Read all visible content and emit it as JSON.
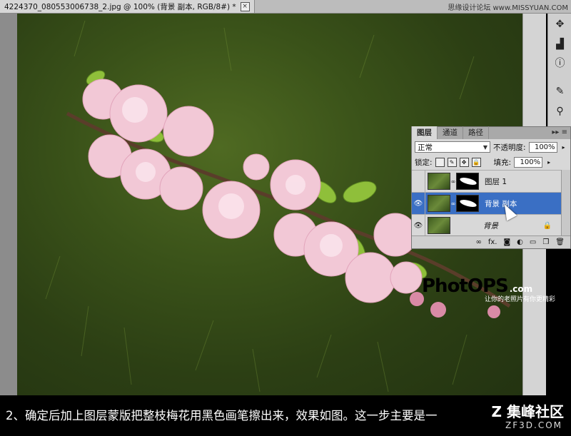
{
  "tab": {
    "title": "4224370_080553006738_2.jpg @ 100% (背景 副本, RGB/8#) *",
    "close": "×"
  },
  "watermark_top": "思缘设计论坛 www.MISSYUAN.COM",
  "layers_panel": {
    "tabs": [
      "图层",
      "通道",
      "路径"
    ],
    "blend_mode": "正常",
    "opacity_label": "不透明度:",
    "opacity_value": "100%",
    "lock_label": "锁定:",
    "fill_label": "填充:",
    "fill_value": "100%",
    "layers": [
      {
        "name": "图层 1",
        "visible": false
      },
      {
        "name": "背景 副本",
        "visible": true,
        "selected": true
      },
      {
        "name": "背景",
        "visible": true,
        "locked": true
      }
    ]
  },
  "logo": {
    "brand": "PhotOPS",
    "suffix": ".com",
    "slogan": "让你的老照片有你更精彩"
  },
  "caption": {
    "text": "2、确定后加上图层蒙版把整枝梅花用黑色画笔擦出来，效果如图。这一步主要是一",
    "brand": "Z 集峰社区",
    "url": "ZF3D.COM"
  },
  "colors": {
    "selected_layer": "#3a6fc4",
    "logo_red": "#e8142c"
  }
}
